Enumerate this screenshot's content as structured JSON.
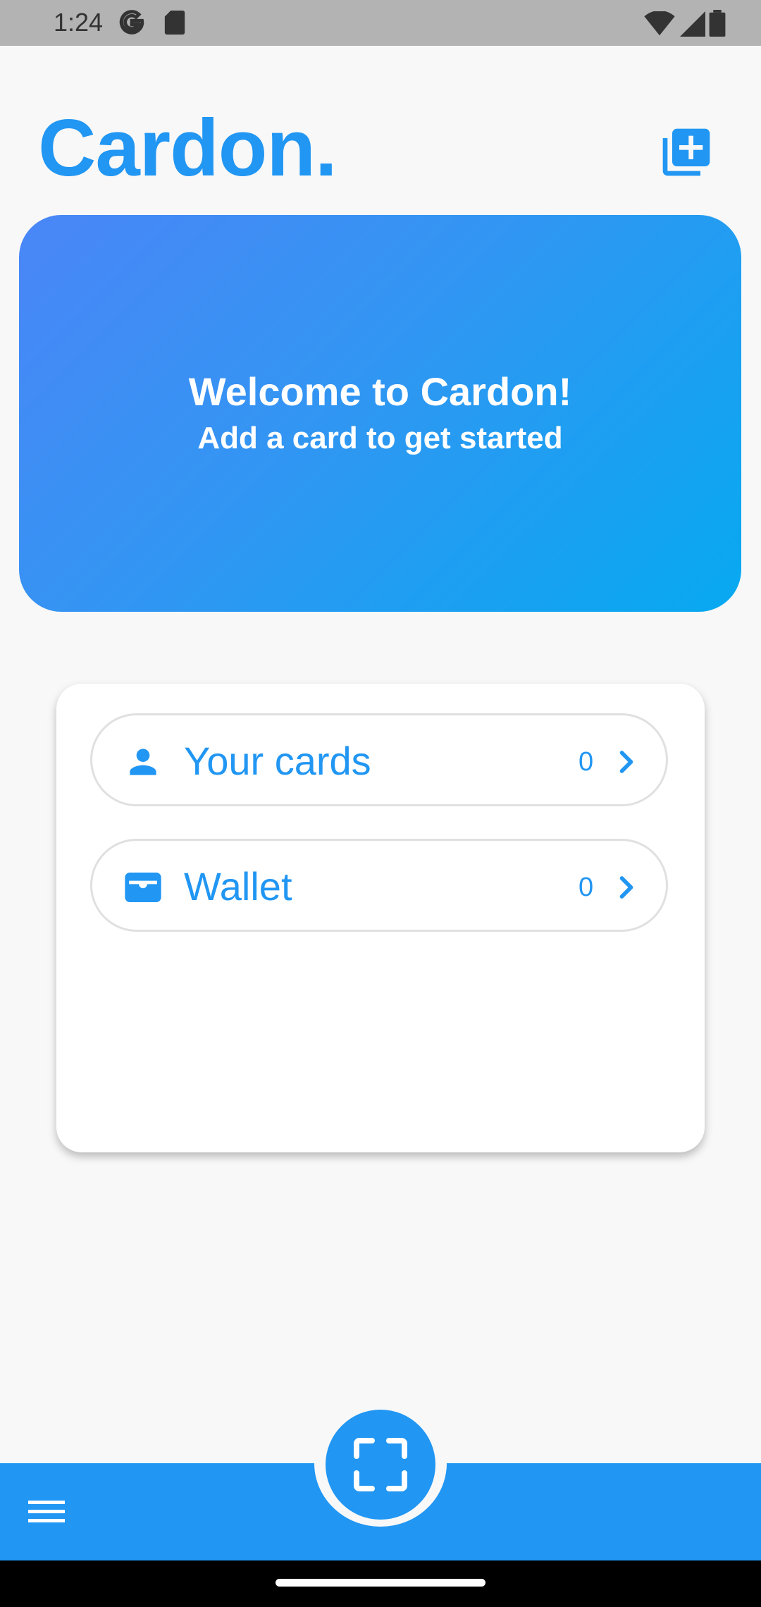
{
  "status": {
    "time": "1:24"
  },
  "header": {
    "title": "Cardon."
  },
  "welcome": {
    "title": "Welcome to Cardon!",
    "subtitle": "Add a card to get started"
  },
  "list": [
    {
      "label": "Your cards",
      "count": "0",
      "icon": "person-icon"
    },
    {
      "label": "Wallet",
      "count": "0",
      "icon": "wallet-icon"
    }
  ],
  "colors": {
    "accent": "#2196f3",
    "background": "#f8f8f8"
  }
}
